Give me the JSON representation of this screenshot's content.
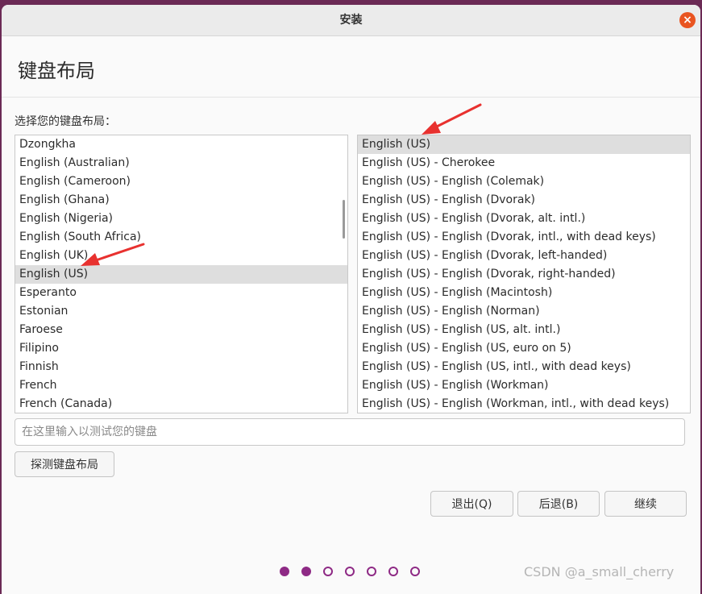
{
  "window": {
    "title": "安装",
    "close_symbol": "×"
  },
  "page": {
    "title": "键盘布局",
    "prompt": "选择您的键盘布局："
  },
  "layouts": {
    "items": [
      "Dzongkha",
      "English (Australian)",
      "English (Cameroon)",
      "English (Ghana)",
      "English (Nigeria)",
      "English (South Africa)",
      "English (UK)",
      "English (US)",
      "Esperanto",
      "Estonian",
      "Faroese",
      "Filipino",
      "Finnish",
      "French",
      "French (Canada)"
    ],
    "selected": "English (US)"
  },
  "variants": {
    "items": [
      "English (US)",
      "English (US) - Cherokee",
      "English (US) - English (Colemak)",
      "English (US) - English (Dvorak)",
      "English (US) - English (Dvorak, alt. intl.)",
      "English (US) - English (Dvorak, intl., with dead keys)",
      "English (US) - English (Dvorak, left-handed)",
      "English (US) - English (Dvorak, right-handed)",
      "English (US) - English (Macintosh)",
      "English (US) - English (Norman)",
      "English (US) - English (US, alt. intl.)",
      "English (US) - English (US, euro on 5)",
      "English (US) - English (US, intl., with dead keys)",
      "English (US) - English (Workman)",
      "English (US) - English (Workman, intl., with dead keys)"
    ],
    "selected": "English (US)"
  },
  "test_input": {
    "placeholder": "在这里输入以测试您的键盘",
    "value": ""
  },
  "buttons": {
    "detect": "探测键盘布局",
    "quit": "退出(Q)",
    "back": "后退(B)",
    "continue": "继续"
  },
  "progress": {
    "total_steps": 7,
    "completed_steps": 2
  },
  "watermark": "CSDN @a_small_cherry",
  "colors": {
    "accent": "#8e2a85",
    "close": "#e95420",
    "arrow": "#e8312f",
    "selection": "#dedede"
  }
}
